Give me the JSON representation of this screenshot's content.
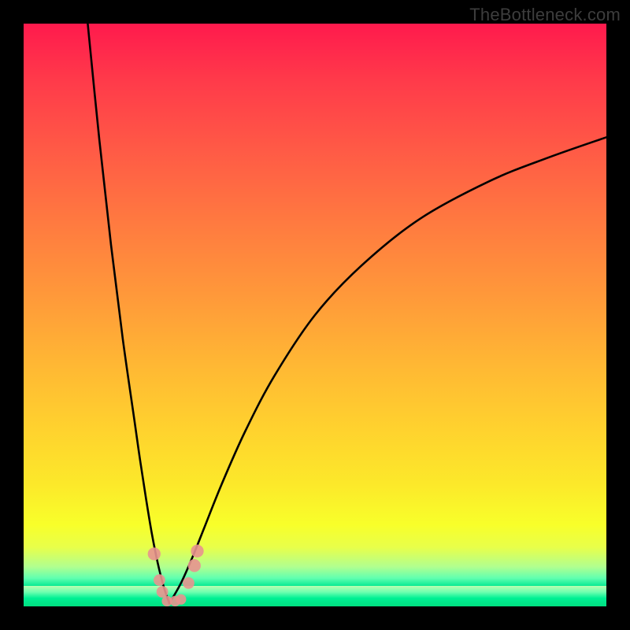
{
  "watermark": "TheBottleneck.com",
  "colors": {
    "frame": "#000000",
    "curve": "#000000",
    "dot": "#e8938f",
    "greenband_top": "#b9ffb0",
    "greenband_bottom": "#00e080",
    "grad_top": "#ff1a4d",
    "grad_bottom": "#00e890"
  },
  "chart_data": {
    "type": "line",
    "title": "",
    "xlabel": "",
    "ylabel": "",
    "xlim": [
      0,
      100
    ],
    "ylim": [
      0,
      100
    ],
    "grid": false,
    "legend": false,
    "x_optimum": 25,
    "green_band_height_pct": 3.5,
    "series": [
      {
        "name": "left-branch",
        "x": [
          11,
          13,
          15,
          17,
          19,
          20,
          21,
          22,
          23,
          24,
          25
        ],
        "y": [
          100,
          80,
          62,
          46,
          32,
          25,
          18.5,
          12.5,
          7.5,
          3.5,
          0.5
        ]
      },
      {
        "name": "right-branch",
        "x": [
          25,
          27,
          29,
          31,
          34,
          38,
          43,
          50,
          58,
          68,
          80,
          90,
          100
        ],
        "y": [
          0.5,
          4,
          8.5,
          13.5,
          21,
          30,
          39.5,
          50,
          58.5,
          66.5,
          73,
          77,
          80.5
        ]
      }
    ],
    "annotations": [
      {
        "name": "left-dot-upper",
        "x": 22.4,
        "y": 9.0,
        "r": 1.1
      },
      {
        "name": "left-dot-mid",
        "x": 23.3,
        "y": 4.5,
        "r": 1.0
      },
      {
        "name": "left-dot-low",
        "x": 23.8,
        "y": 2.5,
        "r": 1.0
      },
      {
        "name": "min-dot-1",
        "x": 24.6,
        "y": 0.9,
        "r": 0.9
      },
      {
        "name": "min-dot-2",
        "x": 26.0,
        "y": 0.9,
        "r": 0.9
      },
      {
        "name": "min-dot-3",
        "x": 27.0,
        "y": 1.2,
        "r": 0.9
      },
      {
        "name": "right-dot-low",
        "x": 28.3,
        "y": 4.0,
        "r": 1.0
      },
      {
        "name": "right-dot-mid",
        "x": 29.3,
        "y": 7.0,
        "r": 1.1
      },
      {
        "name": "right-dot-upper",
        "x": 29.8,
        "y": 9.5,
        "r": 1.1
      }
    ]
  }
}
